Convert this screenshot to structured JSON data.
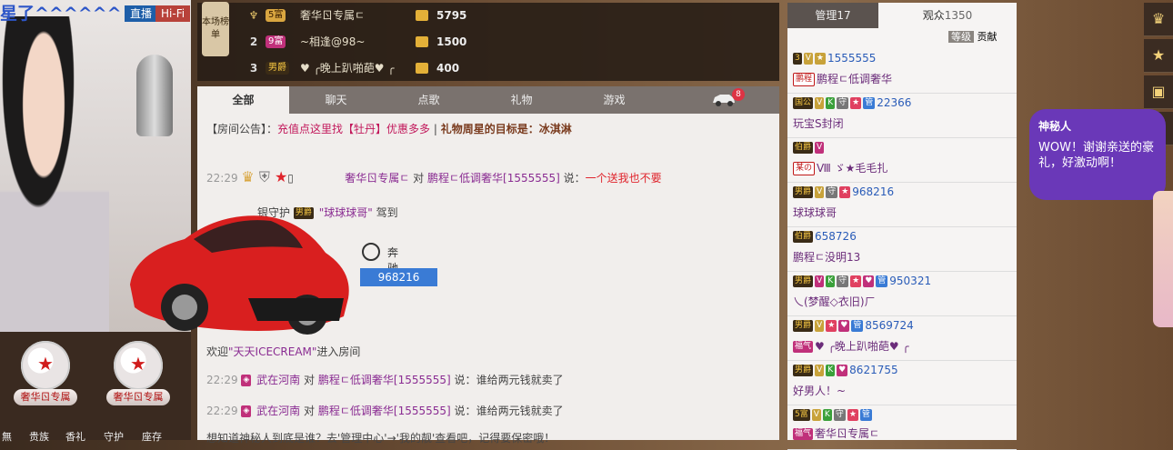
{
  "video": {
    "streamer_name": "星了^^^^^^",
    "live_label": "直播",
    "hifi_label": "Hi-Fi",
    "badges": [
      {
        "label": "奢华ㄖ专属"
      },
      {
        "label": "奢华ㄖ专属"
      }
    ],
    "bottom_tabs": [
      "無",
      "贵族",
      "香礼",
      "守护",
      "座存"
    ]
  },
  "ranking": {
    "tag": "本场榜单",
    "rows": [
      {
        "rank": "1",
        "level": "5富",
        "name": "奢华ㄖ专属ㄷ",
        "amount": "5795",
        "level_color": "#d9a640"
      },
      {
        "rank": "2",
        "level": "9富",
        "name": "~相逢@98~",
        "amount": "1500",
        "level_color": "#c0307a"
      },
      {
        "rank": "3",
        "level": "男爵",
        "name": "♥ ╭晚上趴啪葩♥ ╭",
        "amount": "400",
        "level_color": "#d9a640"
      }
    ]
  },
  "chat": {
    "tabs": [
      "全部",
      "聊天",
      "点歌",
      "礼物",
      "游戏"
    ],
    "car_count": "8",
    "announcement_prefix": "【房间公告】：",
    "announcement_text": "充值点这里找【牡丹】优惠多多",
    "announcement_sep": " | ",
    "announcement_star": "礼物周星的目标是：冰淇淋",
    "msg1": {
      "time": "22:29",
      "user": "奢华ㄖ专属ㄷ",
      "to": "对",
      "target": "鹏程ㄷ低调奢华[1555555]",
      "say": "说：",
      "text": "一个送我也不要"
    },
    "guard_line": {
      "prefix": "银守护",
      "level": "男爵",
      "name": "\"球球球哥\"",
      "suffix": "驾到"
    },
    "car_brand": "奔驰E",
    "car_id": "968216",
    "welcome": {
      "prefix": "欢迎",
      "name": "\"天天ICECREAM\"",
      "suffix": "进入房间"
    },
    "msg2": {
      "time": "22:29",
      "user": "武在河南",
      "to": "对",
      "target": "鹏程ㄷ低调奢华[1555555]",
      "say": "说：",
      "text": "谁给两元钱就卖了"
    },
    "msg3": {
      "time": "22:29",
      "user": "武在河南",
      "to": "对",
      "target": "鹏程ㄷ低调奢华[1555555]",
      "say": "说：",
      "text": "谁给两元钱就卖了"
    },
    "msg4": {
      "text": "想知道神秘人到底是谁？去'管理中心'→'我的靓'查看吧，记得要保密哦！"
    }
  },
  "right_panel": {
    "tab_admin": "管理17",
    "tab_viewers_label": "观众",
    "tab_viewers_count": "1350",
    "level_label": "等级",
    "contrib_label": "贡献",
    "viewers": [
      {
        "badges": [
          "3"
        ],
        "id": "1555555",
        "role": "鹏程",
        "name": "鹏程ㄷ低调奢华"
      },
      {
        "badges": [
          "国公"
        ],
        "id": "22366",
        "role": "",
        "name": "玩宝S封闭"
      },
      {
        "badges": [
          "伯爵"
        ],
        "id": "",
        "role": "某の",
        "name": "Ⅷ ゞ★毛毛扎"
      },
      {
        "badges": [
          "男爵"
        ],
        "id": "968216",
        "role": "",
        "name": "球球球哥"
      },
      {
        "badges": [
          "伯爵"
        ],
        "id": "658726",
        "role": "",
        "name": "鹏程ㄷ没明13"
      },
      {
        "badges": [
          "男爵"
        ],
        "id": "950321",
        "role": "",
        "name": "乀(梦醒◇衣旧)ㄏ"
      },
      {
        "badges": [
          "男爵"
        ],
        "id": "8569724",
        "role": "福气",
        "name": "♥ ╭晚上趴啪葩♥ ╭"
      },
      {
        "badges": [
          "男爵"
        ],
        "id": "8621755",
        "role": "",
        "name": "好男人！~"
      },
      {
        "badges": [
          "5富"
        ],
        "id": "",
        "role": "福气",
        "name": "奢华ㄖ专属ㄷ"
      }
    ]
  },
  "side": {
    "bubble_title": "神秘人",
    "bubble_text": "WOW！谢谢亲送的豪礼，好激动啊！"
  },
  "icons": {
    "crown": "crown-icon",
    "star": "star-icon",
    "gift": "gift-icon",
    "car": "car-icon",
    "coin": "coin-icon"
  }
}
